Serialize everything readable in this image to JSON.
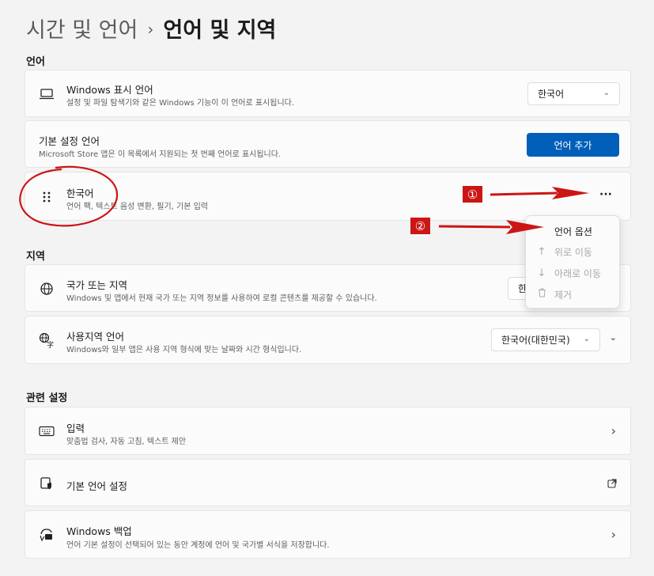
{
  "breadcrumb": {
    "parent": "시간 및 언어",
    "separator": "›",
    "current": "언어 및 지역"
  },
  "sections": {
    "language": "언어",
    "region": "지역",
    "related": "관련 설정"
  },
  "display_language": {
    "title": "Windows 표시 언어",
    "desc": "설정 및 파일 탐색기와 같은 Windows 기능이 이 언어로 표시됩니다.",
    "value": "한국어",
    "icon": "laptop-icon"
  },
  "preferred_languages": {
    "title": "기본 설정 언어",
    "desc": "Microsoft Store 앱은 이 목록에서 지원되는 첫 번째 언어로 표시됩니다.",
    "button": "언어 추가"
  },
  "language_item": {
    "title": "한국어",
    "desc": "언어 팩, 텍스트 음성 변환, 필기, 기본 입력",
    "more": "···",
    "icon": "drag-handle-icon"
  },
  "context_menu": {
    "items": [
      {
        "label": "언어 옵션",
        "icon": "",
        "disabled": false
      },
      {
        "label": "위로 이동",
        "icon": "↑",
        "disabled": true
      },
      {
        "label": "아래로 이동",
        "icon": "↓",
        "disabled": true
      },
      {
        "label": "제거",
        "icon": "trash-icon",
        "disabled": true
      }
    ]
  },
  "country": {
    "title": "국가 또는 지역",
    "desc": "Windows 및 앱에서 현재 국가 또는 지역 정보를 사용하여 로컬 콘텐츠를 제공할 수 있습니다.",
    "value": "한",
    "icon": "globe-icon"
  },
  "regional_format": {
    "title": "사용지역 언어",
    "desc": "Windows와 일부 앱은 사용 지역 형식에 맞는 날짜와 시간 형식입니다.",
    "value": "한국어(대한민국)",
    "icon": "language-format-icon"
  },
  "typing": {
    "title": "입력",
    "desc": "맞춤법 검사, 자동 고침, 텍스트 제안",
    "icon": "keyboard-icon"
  },
  "admin_language": {
    "title": "기본 언어 설정",
    "icon": "admin-shield-icon"
  },
  "backup": {
    "title": "Windows 백업",
    "desc": "언어 기본 설정이 선택되어 있는 동안 계정에 언어 및 국가별 서식을 저장합니다.",
    "icon": "backup-icon"
  },
  "annotations": {
    "badge1": "①",
    "badge2": "②",
    "color": "#cc1515"
  },
  "colors": {
    "accent": "#005fb8",
    "background": "#f3f3f3",
    "card": "#fbfbfb"
  }
}
